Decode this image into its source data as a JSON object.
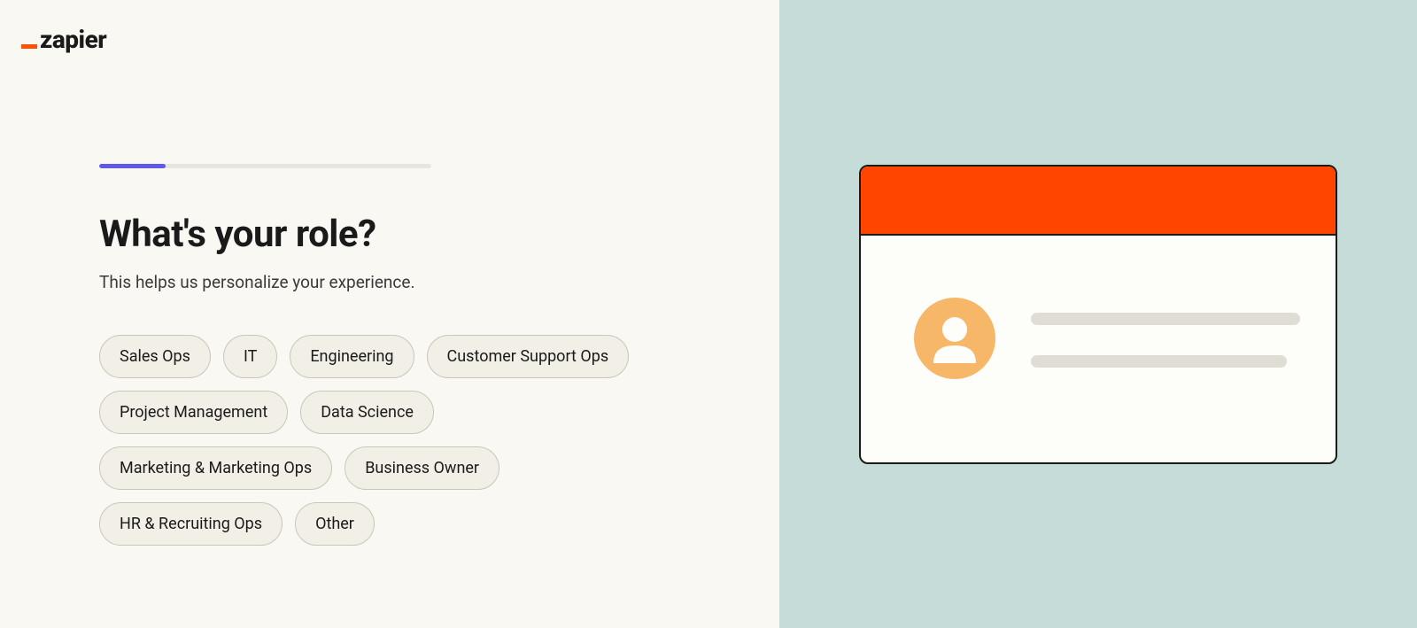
{
  "brand": {
    "name": "zapier",
    "accent_color": "#ff4f00"
  },
  "progress": {
    "percent": 20
  },
  "heading": "What's your role?",
  "subheading": "This helps us personalize your experience.",
  "roles": [
    "Sales Ops",
    "IT",
    "Engineering",
    "Customer Support Ops",
    "Project Management",
    "Data Science",
    "Marketing & Marketing Ops",
    "Business Owner",
    "HR & Recruiting Ops",
    "Other"
  ],
  "illustration": {
    "card_header_color": "#ff4500",
    "avatar_color": "#f7b768"
  }
}
